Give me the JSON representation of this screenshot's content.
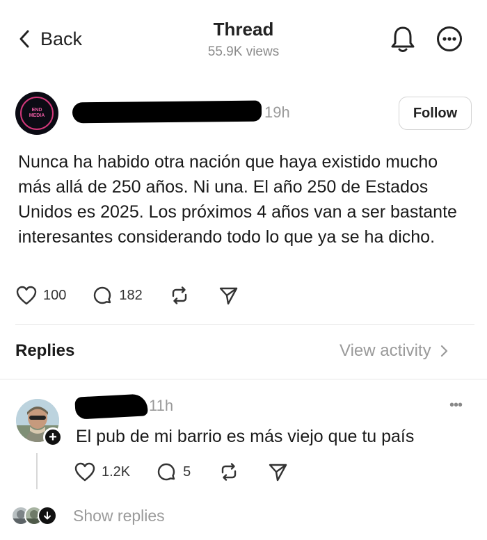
{
  "header": {
    "back_label": "Back",
    "title": "Thread",
    "views": "55.9K views",
    "icons": [
      "chevron-left-icon",
      "bell-icon",
      "more-icon"
    ]
  },
  "post": {
    "author_avatar_text": [
      "END",
      "MEDIA"
    ],
    "time": "19h",
    "follow_label": "Follow",
    "text": "Nunca ha habido otra nación que haya existido mucho más allá de 250 años. Ni una. El año 250 de Estados Unidos es 2025. Los próximos 4 años van a ser bastante interesantes considerando todo lo que ya se ha dicho.",
    "likes": "100",
    "comments": "182"
  },
  "replies_section": {
    "label": "Replies",
    "view_activity": "View activity"
  },
  "reply": {
    "time": "11h",
    "more": "•••",
    "plus": "+",
    "text": "El pub de mi barrio es más viejo que tu país",
    "likes": "1.2K",
    "comments": "5"
  },
  "show_replies": {
    "label": "Show replies"
  },
  "colors": {
    "text": "#1a1a1a",
    "muted": "#9a9a9a",
    "avatar_accent": "#d2387a",
    "divider": "#e6e6e6"
  }
}
